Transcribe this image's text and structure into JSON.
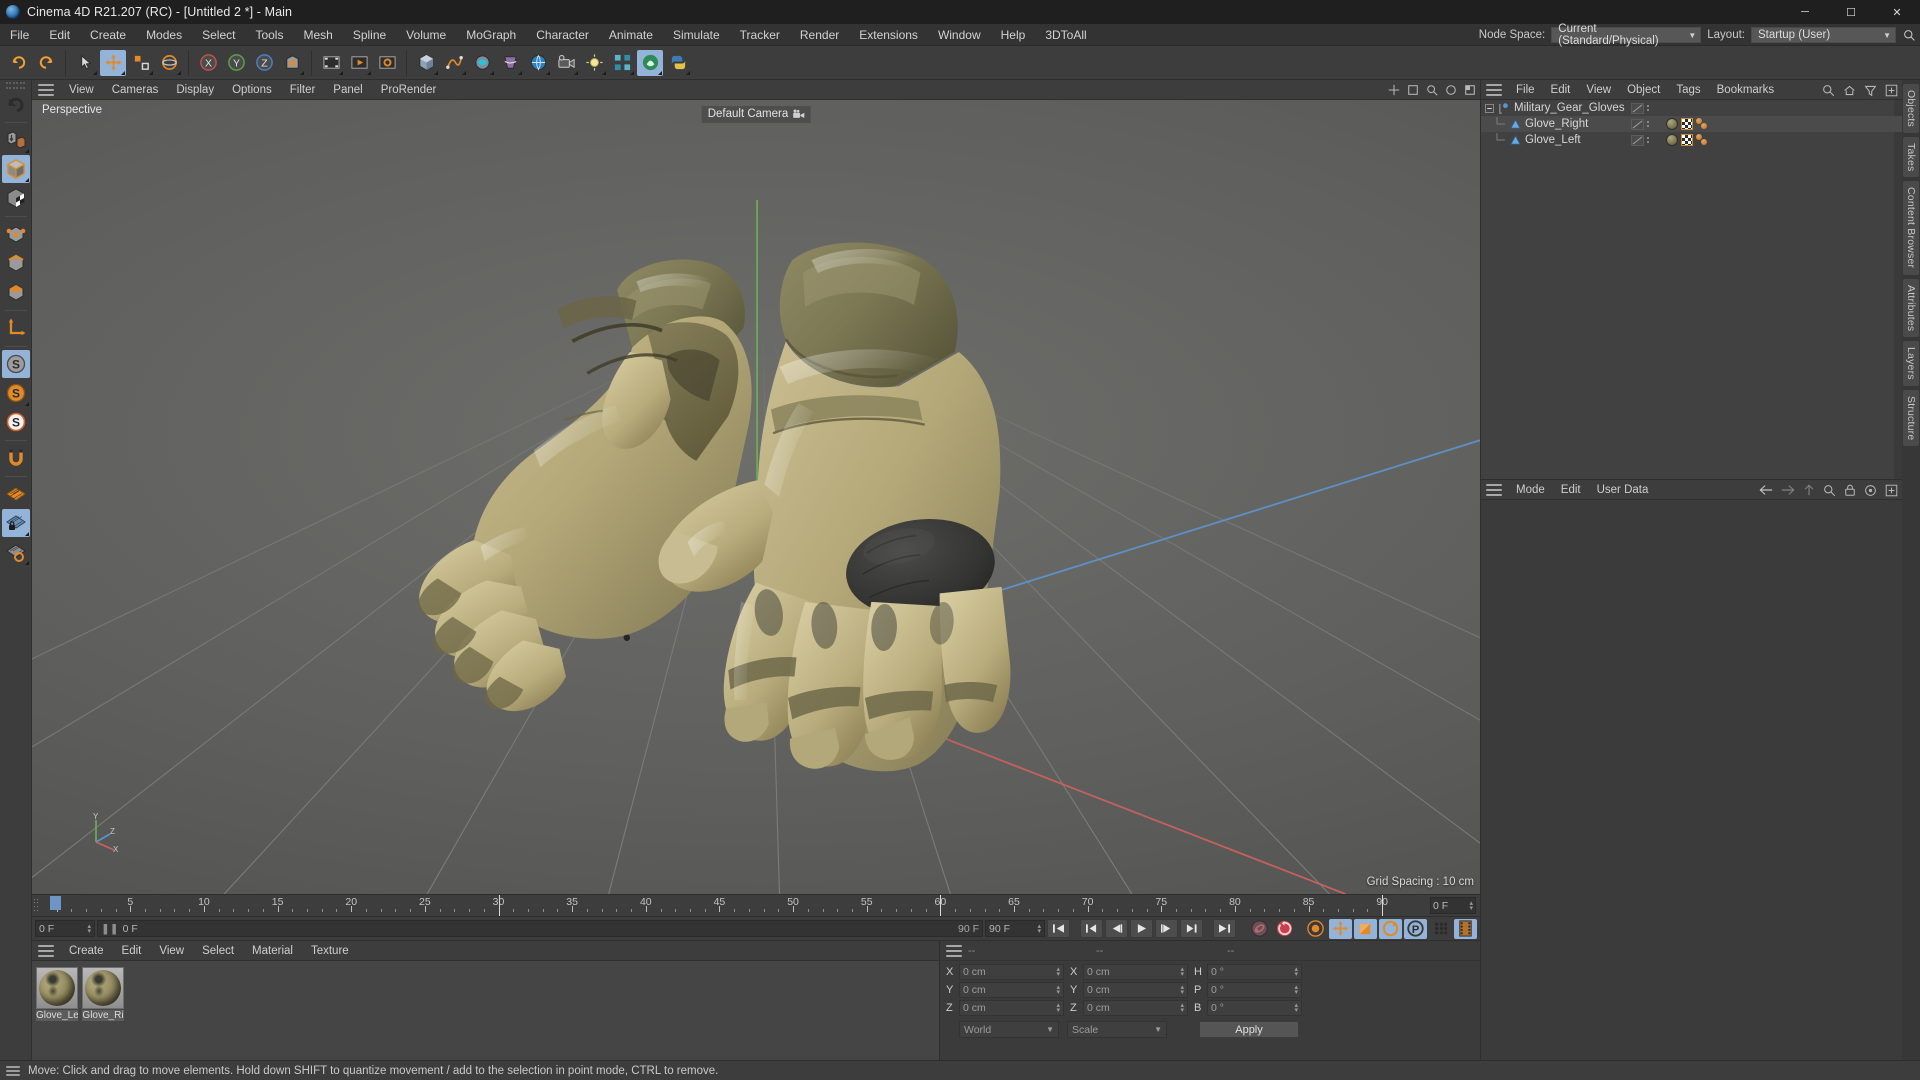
{
  "window": {
    "title": "Cinema 4D R21.207 (RC) - [Untitled 2 *] - Main",
    "logo_icon": "c4d-logo-icon",
    "minimize_label": "─",
    "maximize_label": "☐",
    "close_label": "✕"
  },
  "menubar": {
    "items": [
      {
        "label": "File"
      },
      {
        "label": "Edit"
      },
      {
        "label": "Create"
      },
      {
        "label": "Modes"
      },
      {
        "label": "Select"
      },
      {
        "label": "Tools"
      },
      {
        "label": "Mesh"
      },
      {
        "label": "Spline"
      },
      {
        "label": "Volume"
      },
      {
        "label": "MoGraph"
      },
      {
        "label": "Character"
      },
      {
        "label": "Animate"
      },
      {
        "label": "Simulate"
      },
      {
        "label": "Tracker"
      },
      {
        "label": "Render"
      },
      {
        "label": "Extensions"
      },
      {
        "label": "Window"
      },
      {
        "label": "Help"
      },
      {
        "label": "3DToAll"
      }
    ],
    "node_space_label": "Node Space:",
    "node_space_value": "Current (Standard/Physical)",
    "layout_label": "Layout:",
    "layout_value": "Startup (User)",
    "search_icon": "search-icon",
    "chevron": "⌄"
  },
  "toolbar": {
    "buttons": [
      {
        "name": "undo-button",
        "icon": "undo-icon"
      },
      {
        "name": "redo-button",
        "icon": "redo-icon"
      },
      {
        "name": "live-selection-button",
        "icon": "live-selection-icon"
      },
      {
        "name": "move-tool-button",
        "icon": "move-icon",
        "active": true
      },
      {
        "name": "scale-tool-button",
        "icon": "scale-icon"
      },
      {
        "name": "rotate-tool-button",
        "icon": "rotate-icon"
      },
      {
        "name": "x-axis-lock-button",
        "icon": "axis-x-icon"
      },
      {
        "name": "y-axis-lock-button",
        "icon": "axis-y-icon"
      },
      {
        "name": "z-axis-lock-button",
        "icon": "axis-z-icon"
      },
      {
        "name": "world-object-coord-button",
        "icon": "world-coord-icon"
      },
      {
        "name": "render-view-button",
        "icon": "render-view-icon"
      },
      {
        "name": "render-region-button",
        "icon": "render-queue-icon"
      },
      {
        "name": "render-settings-button",
        "icon": "render-settings-icon"
      },
      {
        "name": "add-cube-button",
        "icon": "cube-icon"
      },
      {
        "name": "add-spline-button",
        "icon": "spline-pen-icon"
      },
      {
        "name": "add-generator-button",
        "icon": "generator-icon"
      },
      {
        "name": "add-deformer-button",
        "icon": "deformer-icon"
      },
      {
        "name": "add-environment-button",
        "icon": "environment-icon"
      },
      {
        "name": "add-camera-button",
        "icon": "camera-icon"
      },
      {
        "name": "add-light-button",
        "icon": "light-icon"
      },
      {
        "name": "mograph-button",
        "icon": "mograph-icon"
      },
      {
        "name": "simulate-button",
        "icon": "simulate-icon"
      },
      {
        "name": "script-button",
        "icon": "python-icon"
      }
    ]
  },
  "left_tools": [
    {
      "name": "undo-view-tool",
      "icon": "undo-view-icon"
    },
    {
      "name": "make-editable-tool",
      "icon": "make-editable-icon"
    },
    {
      "name": "model-mode-tool",
      "icon": "model-mode-icon",
      "active": true
    },
    {
      "name": "texture-mode-tool",
      "icon": "texture-mode-icon"
    },
    {
      "name": "point-mode-tool",
      "icon": "point-mode-icon"
    },
    {
      "name": "edge-mode-tool",
      "icon": "edge-mode-icon"
    },
    {
      "name": "polygon-mode-tool",
      "icon": "polygon-mode-icon"
    },
    {
      "name": "axis-mode-tool",
      "icon": "axis-mode-icon"
    },
    {
      "name": "enable-snap-tool",
      "icon": "snap-gray-icon",
      "active": true
    },
    {
      "name": "snap-settings-tool",
      "icon": "snap-orange-icon"
    },
    {
      "name": "snap-quantize-tool",
      "icon": "snap-white-icon"
    },
    {
      "name": "magnet-tool",
      "icon": "magnet-icon"
    },
    {
      "name": "workplane-tool",
      "icon": "workplane-icon"
    },
    {
      "name": "lock-workplane-tool",
      "icon": "workplane-lock-icon",
      "active": true
    },
    {
      "name": "planar-workplane-tool",
      "icon": "workplane-rotate-icon"
    }
  ],
  "viewport": {
    "menu": [
      {
        "label": "View"
      },
      {
        "label": "Cameras"
      },
      {
        "label": "Display"
      },
      {
        "label": "Options"
      },
      {
        "label": "Filter"
      },
      {
        "label": "Panel"
      },
      {
        "label": "ProRender"
      }
    ],
    "view_label": "Perspective",
    "camera_label": "Default Camera",
    "camera_icon": "camera-small-icon",
    "grid_spacing": "Grid Spacing : 10 cm",
    "axis_x": "X",
    "axis_y": "Y",
    "axis_z": "Z"
  },
  "timeline": {
    "ticks": [
      {
        "label": "0",
        "value": 0
      },
      {
        "label": "5",
        "value": 5
      },
      {
        "label": "10",
        "value": 10
      },
      {
        "label": "15",
        "value": 15
      },
      {
        "label": "20",
        "value": 20
      },
      {
        "label": "25",
        "value": 25
      },
      {
        "label": "30",
        "value": 30
      },
      {
        "label": "35",
        "value": 35
      },
      {
        "label": "40",
        "value": 40
      },
      {
        "label": "45",
        "value": 45
      },
      {
        "label": "50",
        "value": 50
      },
      {
        "label": "55",
        "value": 55
      },
      {
        "label": "60",
        "value": 60
      },
      {
        "label": "65",
        "value": 65
      },
      {
        "label": "70",
        "value": 70
      },
      {
        "label": "75",
        "value": 75
      },
      {
        "label": "80",
        "value": 80
      },
      {
        "label": "85",
        "value": 85
      },
      {
        "label": "90",
        "value": 90
      }
    ],
    "range_min": 0,
    "range_max": 90,
    "current_frame_field": "0 F",
    "playhead_frame": 0
  },
  "transport": {
    "start_frame": "0 F",
    "current_frame": "0 F",
    "end_frame_left": "90 F",
    "end_frame_right": "90 F",
    "buttons": [
      {
        "name": "go-to-start-button",
        "icon": "skip-start-icon"
      },
      {
        "name": "go-to-previous-key-button",
        "icon": "prev-key-icon"
      },
      {
        "name": "step-back-button",
        "icon": "step-back-icon"
      },
      {
        "name": "play-button",
        "icon": "play-icon"
      },
      {
        "name": "step-forward-button",
        "icon": "step-forward-icon"
      },
      {
        "name": "go-to-next-key-button",
        "icon": "next-key-icon"
      },
      {
        "name": "go-to-end-button",
        "icon": "skip-end-icon"
      }
    ],
    "record_buttons": [
      {
        "name": "record-active-objects-button",
        "icon": "record-key-icon"
      },
      {
        "name": "autokeying-button",
        "icon": "autokey-icon"
      },
      {
        "name": "keyframe-selection-button",
        "icon": "keyframe-select-icon"
      },
      {
        "name": "position-key-button",
        "icon": "position-key-icon",
        "active": true
      },
      {
        "name": "scale-key-button",
        "icon": "scale-key-icon",
        "active": true
      },
      {
        "name": "rotation-key-button",
        "icon": "rotation-key-icon",
        "active": true
      },
      {
        "name": "param-key-button",
        "icon": "param-key-icon",
        "active": true
      },
      {
        "name": "point-level-anim-button",
        "icon": "pla-icon"
      },
      {
        "name": "timeline-toggle-button",
        "icon": "film-icon",
        "active": true
      }
    ]
  },
  "material_manager": {
    "menu": [
      {
        "label": "Create"
      },
      {
        "label": "Edit"
      },
      {
        "label": "View"
      },
      {
        "label": "Select"
      },
      {
        "label": "Material"
      },
      {
        "label": "Texture"
      }
    ],
    "materials": [
      {
        "name": "Glove_Le",
        "full_name": "Glove_Left"
      },
      {
        "name": "Glove_Ri",
        "full_name": "Glove_Right"
      }
    ]
  },
  "coordinates": {
    "col_headers": [
      "--",
      "--",
      "--"
    ],
    "rows": [
      {
        "pos_label": "X",
        "pos_value": "0 cm",
        "size_label": "X",
        "size_value": "0 cm",
        "rot_label": "H",
        "rot_value": "0 °"
      },
      {
        "pos_label": "Y",
        "pos_value": "0 cm",
        "size_label": "Y",
        "size_value": "0 cm",
        "rot_label": "P",
        "rot_value": "0 °"
      },
      {
        "pos_label": "Z",
        "pos_value": "0 cm",
        "size_label": "Z",
        "size_value": "0 cm",
        "rot_label": "B",
        "rot_value": "0 °"
      }
    ],
    "system_select": "World",
    "mode_select": "Scale",
    "apply_button": "Apply"
  },
  "object_manager": {
    "menu": [
      {
        "label": "File"
      },
      {
        "label": "Edit"
      },
      {
        "label": "View"
      },
      {
        "label": "Object"
      },
      {
        "label": "Tags"
      },
      {
        "label": "Bookmarks"
      }
    ],
    "icons": [
      "search-icon",
      "home-icon",
      "filter-icon",
      "plus-icon"
    ],
    "items": [
      {
        "name": "Military_Gear_Gloves",
        "type": "null-object",
        "indent": 0,
        "selected": false,
        "has_material": false
      },
      {
        "name": "Glove_Right",
        "type": "polygon-object",
        "indent": 1,
        "selected": true,
        "has_material": true
      },
      {
        "name": "Glove_Left",
        "type": "polygon-object",
        "indent": 1,
        "selected": false,
        "has_material": true
      }
    ]
  },
  "attribute_manager": {
    "menu": [
      {
        "label": "Mode"
      },
      {
        "label": "Edit"
      },
      {
        "label": "User Data"
      }
    ],
    "icons": [
      "back-arrow-icon",
      "forward-arrow-icon",
      "up-arrow-icon",
      "search-icon",
      "lock-icon",
      "target-icon",
      "plus-icon"
    ]
  },
  "right_tabs": [
    {
      "label": "Objects"
    },
    {
      "label": "Takes"
    },
    {
      "label": "Content Browser"
    },
    {
      "label": "Attributes"
    },
    {
      "label": "Layers"
    },
    {
      "label": "Structure"
    }
  ],
  "statusbar": {
    "message": "Move: Click and drag to move elements. Hold down SHIFT to quantize movement / add to the selection in point mode, CTRL to remove."
  },
  "colors": {
    "accent_blue": "#93b4d8",
    "accent_orange": "#e08a2a",
    "panel_bg": "#3b3b3b",
    "header_bg": "#3d3d3d",
    "axis_x_red": "#c0504d",
    "axis_y_green": "#5a9e4a",
    "axis_z_blue": "#4a7fc0"
  }
}
